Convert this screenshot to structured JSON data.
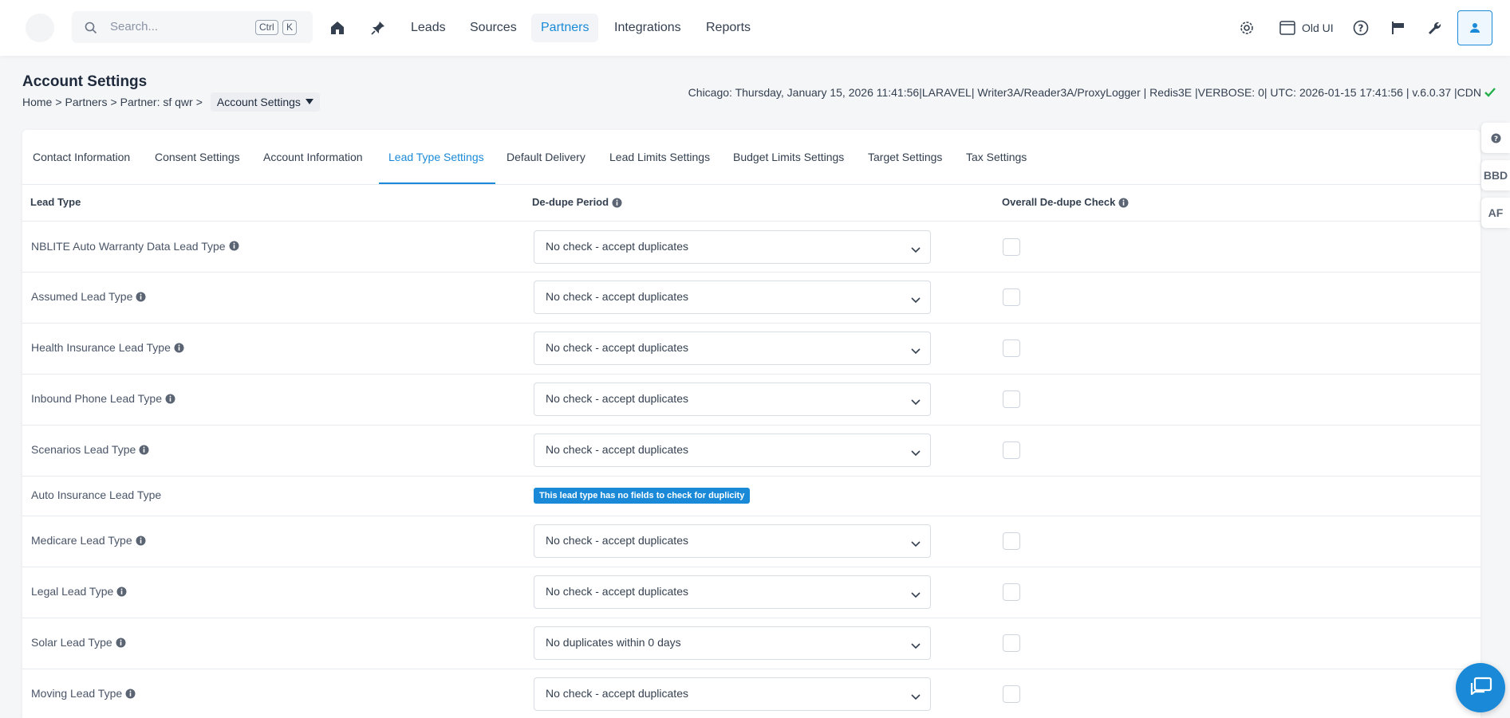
{
  "navbar": {
    "search_placeholder": "Search...",
    "shortcut_ctrl": "Ctrl",
    "shortcut_key": "K",
    "links": [
      "Leads",
      "Sources",
      "Partners",
      "Integrations",
      "Reports"
    ],
    "active_link": "Partners",
    "old_ui_label": "Old UI"
  },
  "header": {
    "title": "Account Settings",
    "breadcrumb": [
      "Home",
      "Partners",
      "Partner: sf qwr"
    ],
    "breadcrumb_sep": ">",
    "current_page": "Account Settings",
    "status_line": "Chicago: Thursday, January 15, 2026 11:41:56|LARAVEL| Writer3A/Reader3A/ProxyLogger | Redis3E |VERBOSE: 0| UTC: 2026-01-15 17:41:56 | v.6.0.37 |CDN"
  },
  "tabs": [
    "Contact Information",
    "Consent Settings",
    "Account Information",
    "Lead Type Settings",
    "Default Delivery",
    "Lead Limits Settings",
    "Budget Limits Settings",
    "Target Settings",
    "Tax Settings"
  ],
  "active_tab": "Lead Type Settings",
  "table": {
    "headers": {
      "lead_type": "Lead Type",
      "dedupe_period": "De-dupe Period",
      "overall_check": "Overall De-dupe Check"
    },
    "rows": [
      {
        "name": "NBLITE Auto Warranty Data Lead Type",
        "dedupe": "No check - accept duplicates",
        "checked": false
      },
      {
        "name": "Assumed Lead Type",
        "dedupe": "No check - accept duplicates",
        "checked": false
      },
      {
        "name": "Health Insurance Lead Type",
        "dedupe": "No check - accept duplicates",
        "checked": false
      },
      {
        "name": "Inbound Phone Lead Type",
        "dedupe": "No check - accept duplicates",
        "checked": false
      },
      {
        "name": "Scenarios Lead Type",
        "dedupe": "No check - accept duplicates",
        "checked": false
      },
      {
        "name": "Auto Insurance Lead Type",
        "badge": "This lead type has no fields to check for duplicity"
      },
      {
        "name": "Medicare Lead Type",
        "dedupe": "No check - accept duplicates",
        "checked": false
      },
      {
        "name": "Legal Lead Type",
        "dedupe": "No check - accept duplicates",
        "checked": false
      },
      {
        "name": "Solar Lead Type",
        "dedupe": "No duplicates within 0 days",
        "checked": false
      },
      {
        "name": "Moving Lead Type",
        "dedupe": "No check - accept duplicates",
        "checked": false
      }
    ]
  },
  "side_tabs": [
    "BBD",
    "AF"
  ],
  "colors": {
    "accent": "#1a8ad8",
    "success": "#22b04b"
  }
}
